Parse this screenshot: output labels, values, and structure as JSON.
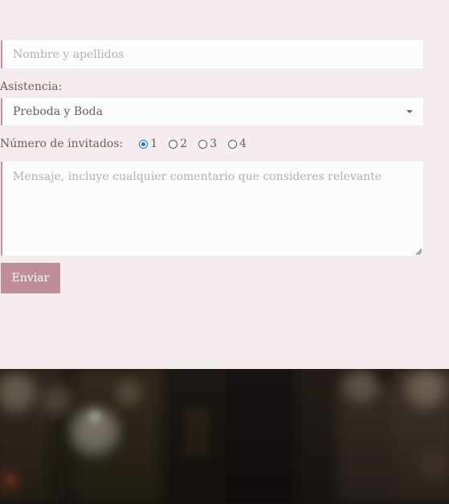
{
  "form": {
    "name_placeholder": "Nombre y apellidos",
    "attendance_label": "Asistencia:",
    "attendance_selected": "Preboda y Boda",
    "guests_label": "Número de invitados:",
    "guest_options": [
      "1",
      "2",
      "3",
      "4"
    ],
    "guest_selected": "1",
    "message_placeholder": "Mensaje, incluye cualquier comentario que consideres relevante",
    "submit_label": "Enviar"
  },
  "icons": {
    "select_caret": "chevron-down-icon",
    "resize_handle": "resize-handle-icon"
  },
  "colors": {
    "page_background": "#f5eded",
    "field_background": "#fdfcfc",
    "accent": "#bf8f99",
    "field_border": "#c0929c",
    "text": "#6b5d5d",
    "radio_checked": "#1a73e8"
  }
}
